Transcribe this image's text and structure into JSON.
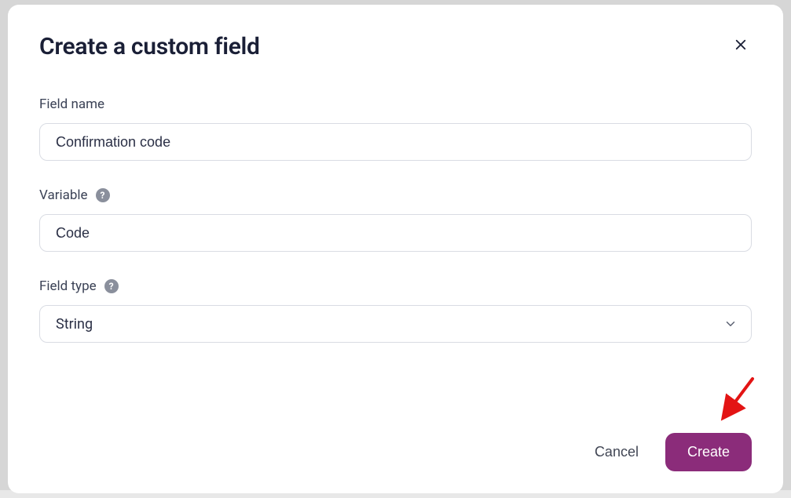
{
  "modal": {
    "title": "Create a custom field",
    "fields": {
      "field_name": {
        "label": "Field name",
        "value": "Confirmation code"
      },
      "variable": {
        "label": "Variable",
        "value": "Code"
      },
      "field_type": {
        "label": "Field type",
        "selected": "String"
      }
    },
    "buttons": {
      "cancel": "Cancel",
      "create": "Create"
    }
  }
}
